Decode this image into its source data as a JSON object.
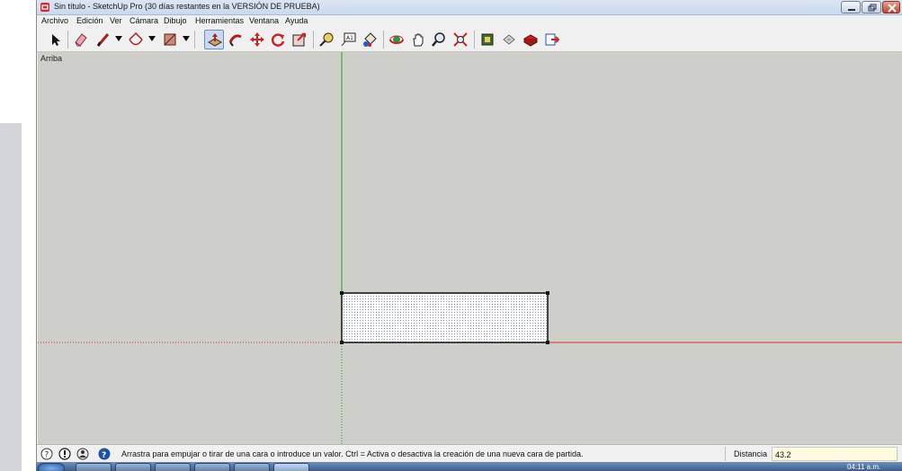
{
  "window": {
    "title": "Sin título - SketchUp Pro (30 días restantes en la VERSIÓN DE PRUEBA)"
  },
  "menu": {
    "items": [
      {
        "label": "Archivo"
      },
      {
        "label": "Edición"
      },
      {
        "label": "Ver"
      },
      {
        "label": "Cámara"
      },
      {
        "label": "Dibujo"
      },
      {
        "label": "Herramientas"
      },
      {
        "label": "Ventana"
      },
      {
        "label": "Ayuda"
      }
    ]
  },
  "toolbar": {
    "tools": [
      {
        "icon": "select-arrow-icon"
      },
      {
        "icon": "eraser-icon"
      },
      {
        "icon": "pencil-line-icon"
      },
      {
        "icon": "arc-icon"
      },
      {
        "icon": "rectangle-icon"
      },
      {
        "icon": "push-pull-icon",
        "active": true
      },
      {
        "icon": "follow-me-icon"
      },
      {
        "icon": "move-icon"
      },
      {
        "icon": "rotate-icon"
      },
      {
        "icon": "scale-icon"
      },
      {
        "icon": "tape-measure-icon"
      },
      {
        "icon": "text-icon"
      },
      {
        "icon": "paint-bucket-icon"
      },
      {
        "icon": "orbit-icon"
      },
      {
        "icon": "pan-icon"
      },
      {
        "icon": "zoom-icon"
      },
      {
        "icon": "zoom-extents-icon"
      },
      {
        "icon": "3d-warehouse-icon"
      },
      {
        "icon": "share-model-icon"
      },
      {
        "icon": "extension-warehouse-icon"
      },
      {
        "icon": "layout-icon"
      }
    ]
  },
  "viewport": {
    "view_name": "Arriba",
    "colors": {
      "background": "#cfcfca",
      "green_axis": "#2e9a2e",
      "red_axis": "#d23030"
    }
  },
  "statusbar": {
    "message": "Arrastra para empujar o tirar de una cara o introduce un valor. Ctrl = Activa o desactiva la creación de una nueva cara de partida.",
    "measurement_label": "Distancia",
    "measurement_value": "43.2"
  },
  "taskbar": {
    "clock": "04:11 a.m."
  }
}
